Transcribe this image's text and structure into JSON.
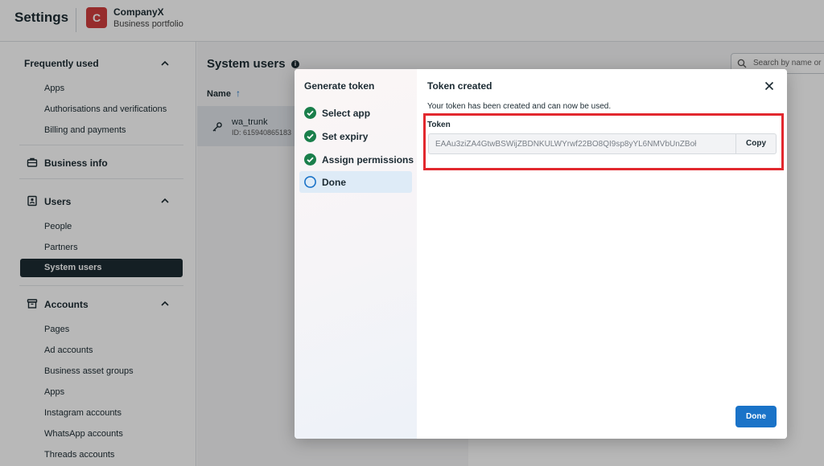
{
  "topbar": {
    "title": "Settings",
    "avatar_letter": "C",
    "company_name": "CompanyX",
    "company_subtitle": "Business portfolio"
  },
  "sidebar": {
    "frequently_used": {
      "label": "Frequently used",
      "items": [
        "Apps",
        "Authorisations and verifications",
        "Billing and payments"
      ]
    },
    "business_info": {
      "label": "Business info"
    },
    "users": {
      "label": "Users",
      "items": [
        "People",
        "Partners",
        "System users"
      ],
      "active": "System users"
    },
    "accounts": {
      "label": "Accounts",
      "items": [
        "Pages",
        "Ad accounts",
        "Business asset groups",
        "Apps",
        "Instagram accounts",
        "WhatsApp accounts",
        "Threads accounts"
      ]
    }
  },
  "main": {
    "title": "System users",
    "info_icon": "i",
    "column_name": "Name",
    "sort_icon": "↑",
    "search_placeholder": "Search by name or",
    "row": {
      "name": "wa_trunk",
      "id": "ID: 615940865183"
    }
  },
  "modal": {
    "steps_title": "Generate token",
    "steps": [
      {
        "label": "Select app",
        "status": "complete"
      },
      {
        "label": "Set expiry",
        "status": "complete"
      },
      {
        "label": "Assign permissions",
        "status": "complete"
      },
      {
        "label": "Done",
        "status": "current"
      }
    ],
    "title": "Token created",
    "description": "Your token has been created and can now be used.",
    "token_label": "Token",
    "token_value": "EAAu3ziZA4GtwBSWijZBDNKULWYrwf22BO8QI9sp8yYL6NMVbUnZBoł",
    "copy_label": "Copy",
    "done_label": "Done"
  },
  "colors": {
    "accent": "#1a73c8",
    "step_complete": "#1a7f4b",
    "highlight": "#e2282e",
    "active_nav": "#1c2b33"
  }
}
